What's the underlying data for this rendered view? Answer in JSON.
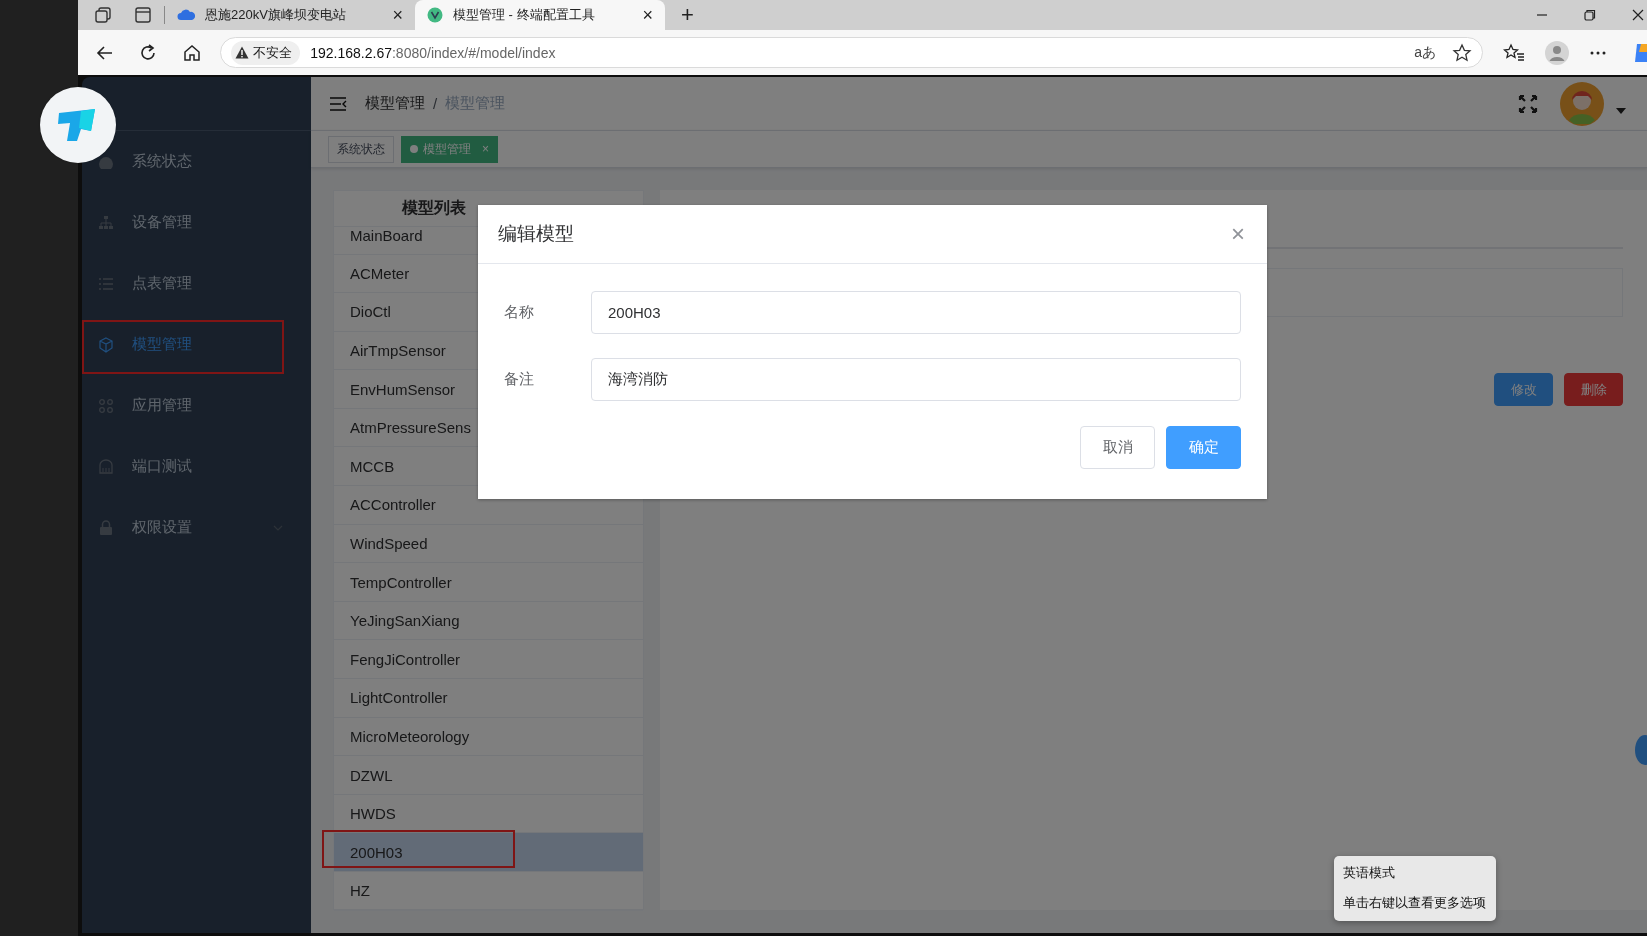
{
  "browser": {
    "tabs": [
      {
        "title": "恩施220kV旗峰坝变电站",
        "selected": false,
        "close": "×"
      },
      {
        "title": "模型管理 - 终端配置工具",
        "selected": true,
        "close": "×"
      }
    ],
    "new_tab": "+",
    "security": "不安全",
    "url_host": "192.168.2.67",
    "url_rest": ":8080/index/#/model/index",
    "read_aloud": "aあ"
  },
  "sidebar": {
    "items": [
      {
        "label": "系统状态",
        "selected": false,
        "submenu": false,
        "highlighted": false
      },
      {
        "label": "设备管理",
        "selected": false,
        "submenu": false,
        "highlighted": false
      },
      {
        "label": "点表管理",
        "selected": false,
        "submenu": false,
        "highlighted": false
      },
      {
        "label": "模型管理",
        "selected": true,
        "submenu": false,
        "highlighted": true
      },
      {
        "label": "应用管理",
        "selected": false,
        "submenu": false,
        "highlighted": false
      },
      {
        "label": "端口测试",
        "selected": false,
        "submenu": false,
        "highlighted": false
      },
      {
        "label": "权限设置",
        "selected": false,
        "submenu": true,
        "highlighted": false
      }
    ]
  },
  "header": {
    "breadcrumb": [
      {
        "label": "模型管理",
        "current": false
      },
      {
        "label": "模型管理",
        "current": true
      }
    ],
    "separator": "/"
  },
  "tags": [
    {
      "label": "系统状态",
      "selected": false
    },
    {
      "label": "模型管理",
      "selected": true,
      "close": "×"
    }
  ],
  "model_list": {
    "title": "模型列表",
    "items": [
      {
        "name": "MainBoard",
        "selected": false,
        "highlighted": false
      },
      {
        "name": "ACMeter",
        "selected": false,
        "highlighted": false
      },
      {
        "name": "DioCtl",
        "selected": false,
        "highlighted": false
      },
      {
        "name": "AirTmpSensor",
        "selected": false,
        "highlighted": false
      },
      {
        "name": "EnvHumSensor",
        "selected": false,
        "highlighted": false
      },
      {
        "name": "AtmPressureSens",
        "selected": false,
        "highlighted": false
      },
      {
        "name": "MCCB",
        "selected": false,
        "highlighted": false
      },
      {
        "name": "ACController",
        "selected": false,
        "highlighted": false
      },
      {
        "name": "WindSpeed",
        "selected": false,
        "highlighted": false
      },
      {
        "name": "TempController",
        "selected": false,
        "highlighted": false
      },
      {
        "name": "YeJingSanXiang",
        "selected": false,
        "highlighted": false
      },
      {
        "name": "FengJiController",
        "selected": false,
        "highlighted": false
      },
      {
        "name": "LightController",
        "selected": false,
        "highlighted": false
      },
      {
        "name": "MicroMeteorology",
        "selected": false,
        "highlighted": false
      },
      {
        "name": "DZWL",
        "selected": false,
        "highlighted": false
      },
      {
        "name": "HWDS",
        "selected": false,
        "highlighted": false
      },
      {
        "name": "200H03",
        "selected": true,
        "highlighted": true
      },
      {
        "name": "HZ",
        "selected": false,
        "highlighted": false
      }
    ]
  },
  "detail": {
    "buttons": [
      {
        "label": "修改",
        "kind": "primary"
      },
      {
        "label": "删除",
        "kind": "danger"
      }
    ]
  },
  "dialog": {
    "title": "编辑模型",
    "close": "×",
    "fields": [
      {
        "label": "名称",
        "value": "200H03"
      },
      {
        "label": "备注",
        "value": "海湾消防"
      }
    ],
    "buttons": [
      {
        "label": "取消",
        "kind": "default"
      },
      {
        "label": "确定",
        "kind": "primary"
      }
    ]
  },
  "tooltip": {
    "lines": [
      "英语模式",
      "单击右键以查看更多选项"
    ]
  }
}
